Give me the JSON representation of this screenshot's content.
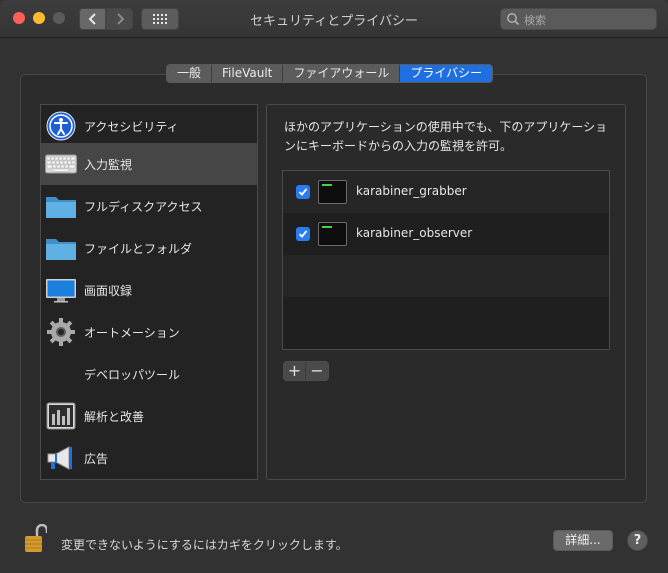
{
  "window": {
    "title": "セキュリティとプライバシー",
    "search_placeholder": "検索"
  },
  "tabs": [
    {
      "label": "一般",
      "active": false
    },
    {
      "label": "FileVault",
      "active": false
    },
    {
      "label": "ファイアウォール",
      "active": false
    },
    {
      "label": "プライバシー",
      "active": true
    }
  ],
  "sidebar": {
    "items": [
      {
        "label": "アクセシビリティ",
        "icon": "accessibility-icon",
        "selected": false
      },
      {
        "label": "入力監視",
        "icon": "keyboard-icon",
        "selected": true
      },
      {
        "label": "フルディスクアクセス",
        "icon": "folder-icon",
        "selected": false
      },
      {
        "label": "ファイルとフォルダ",
        "icon": "folder-icon",
        "selected": false
      },
      {
        "label": "画面収録",
        "icon": "display-icon",
        "selected": false
      },
      {
        "label": "オートメーション",
        "icon": "gear-icon",
        "selected": false
      },
      {
        "label": "デベロッパツール",
        "icon": "",
        "selected": false
      },
      {
        "label": "解析と改善",
        "icon": "analytics-icon",
        "selected": false
      },
      {
        "label": "広告",
        "icon": "megaphone-icon",
        "selected": false
      }
    ]
  },
  "panel": {
    "description_line1": "ほかのアプリケーションの使用中でも、下のアプリケーショ",
    "description_line2": "ンにキーボードからの入力の監視を許可。",
    "apps": [
      {
        "name": "karabiner_grabber",
        "checked": true
      },
      {
        "name": "karabiner_observer",
        "checked": true
      }
    ],
    "add_label": "+",
    "remove_label": "−"
  },
  "footer": {
    "lock_text": "変更できないようにするにはカギをクリックします。",
    "details_label": "詳細...",
    "help_label": "?"
  },
  "colors": {
    "accent": "#1f6fe0",
    "checkbox": "#2a7cf0",
    "window_bg": "#323232"
  }
}
